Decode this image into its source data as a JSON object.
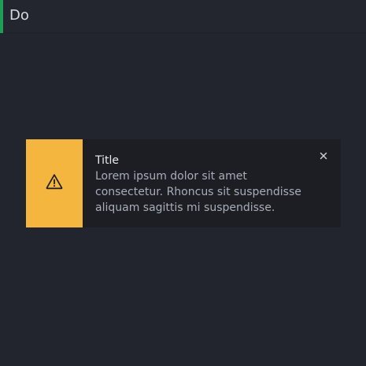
{
  "header": {
    "label": "Do",
    "accent_color": "#1f9d55"
  },
  "notification": {
    "type": "warning",
    "icon": "warning-icon",
    "accent_color": "#f4b63e",
    "title": "Title",
    "message": "Lorem ipsum dolor sit amet consectetur. Rhoncus sit suspendisse aliquam sagittis mi suspendisse.",
    "close_icon": "close-icon"
  }
}
